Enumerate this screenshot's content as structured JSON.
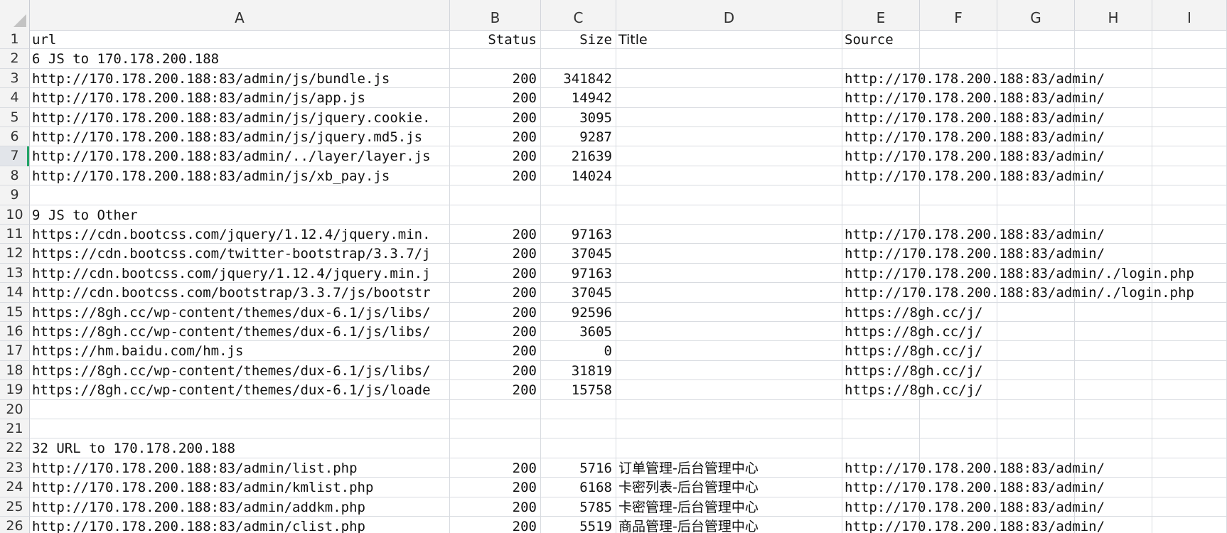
{
  "columns": [
    "A",
    "B",
    "C",
    "D",
    "E",
    "F",
    "G",
    "H",
    "I"
  ],
  "rows": [
    {
      "n": "1",
      "A": "url",
      "B": "Status",
      "C": "Size",
      "D": "Title",
      "E": "Source"
    },
    {
      "n": "2",
      "A": "6 JS to 170.178.200.188"
    },
    {
      "n": "3",
      "A": "http://170.178.200.188:83/admin/js/bundle.js",
      "B": "200",
      "C": "341842",
      "D": "",
      "E": "http://170.178.200.188:83/admin/"
    },
    {
      "n": "4",
      "A": "http://170.178.200.188:83/admin/js/app.js",
      "B": "200",
      "C": "14942",
      "D": "",
      "E": "http://170.178.200.188:83/admin/"
    },
    {
      "n": "5",
      "A": "http://170.178.200.188:83/admin/js/jquery.cookie.",
      "B": "200",
      "C": "3095",
      "D": "",
      "E": "http://170.178.200.188:83/admin/"
    },
    {
      "n": "6",
      "A": "http://170.178.200.188:83/admin/js/jquery.md5.js",
      "B": "200",
      "C": "9287",
      "D": "",
      "E": "http://170.178.200.188:83/admin/"
    },
    {
      "n": "7",
      "A": "http://170.178.200.188:83/admin/../layer/layer.js",
      "B": "200",
      "C": "21639",
      "D": "",
      "E": "http://170.178.200.188:83/admin/"
    },
    {
      "n": "8",
      "A": "http://170.178.200.188:83/admin/js/xb_pay.js",
      "B": "200",
      "C": "14024",
      "D": "",
      "E": "http://170.178.200.188:83/admin/"
    },
    {
      "n": "9"
    },
    {
      "n": "10",
      "A": "9 JS to Other"
    },
    {
      "n": "11",
      "A": "https://cdn.bootcss.com/jquery/1.12.4/jquery.min.",
      "B": "200",
      "C": "97163",
      "D": "",
      "E": "http://170.178.200.188:83/admin/"
    },
    {
      "n": "12",
      "A": "https://cdn.bootcss.com/twitter-bootstrap/3.3.7/j",
      "B": "200",
      "C": "37045",
      "D": "",
      "E": "http://170.178.200.188:83/admin/"
    },
    {
      "n": "13",
      "A": "http://cdn.bootcss.com/jquery/1.12.4/jquery.min.j",
      "B": "200",
      "C": "97163",
      "D": "",
      "E": "http://170.178.200.188:83/admin/./login.php"
    },
    {
      "n": "14",
      "A": "http://cdn.bootcss.com/bootstrap/3.3.7/js/bootstr",
      "B": "200",
      "C": "37045",
      "D": "",
      "E": "http://170.178.200.188:83/admin/./login.php"
    },
    {
      "n": "15",
      "A": "https://8gh.cc/wp-content/themes/dux-6.1/js/libs/",
      "B": "200",
      "C": "92596",
      "D": "",
      "E": "https://8gh.cc/j/"
    },
    {
      "n": "16",
      "A": "https://8gh.cc/wp-content/themes/dux-6.1/js/libs/",
      "B": "200",
      "C": "3605",
      "D": "",
      "E": "https://8gh.cc/j/"
    },
    {
      "n": "17",
      "A": "https://hm.baidu.com/hm.js",
      "B": "200",
      "C": "0",
      "D": "",
      "E": "https://8gh.cc/j/"
    },
    {
      "n": "18",
      "A": "https://8gh.cc/wp-content/themes/dux-6.1/js/libs/",
      "B": "200",
      "C": "31819",
      "D": "",
      "E": "https://8gh.cc/j/"
    },
    {
      "n": "19",
      "A": "https://8gh.cc/wp-content/themes/dux-6.1/js/loade",
      "B": "200",
      "C": "15758",
      "D": "",
      "E": "https://8gh.cc/j/"
    },
    {
      "n": "20"
    },
    {
      "n": "21"
    },
    {
      "n": "22",
      "A": "32 URL to 170.178.200.188"
    },
    {
      "n": "23",
      "A": "http://170.178.200.188:83/admin/list.php",
      "B": "200",
      "C": "5716",
      "D": "订单管理-后台管理中心",
      "E": "http://170.178.200.188:83/admin/"
    },
    {
      "n": "24",
      "A": "http://170.178.200.188:83/admin/kmlist.php",
      "B": "200",
      "C": "6168",
      "D": "卡密列表-后台管理中心",
      "E": "http://170.178.200.188:83/admin/"
    },
    {
      "n": "25",
      "A": "http://170.178.200.188:83/admin/addkm.php",
      "B": "200",
      "C": "5785",
      "D": "卡密管理-后台管理中心",
      "E": "http://170.178.200.188:83/admin/"
    },
    {
      "n": "26",
      "A": "http://170.178.200.188:83/admin/clist.php",
      "B": "200",
      "C": "5519",
      "D": "商品管理-后台管理中心",
      "E": "http://170.178.200.188:83/admin/"
    }
  ],
  "selected_row": "7",
  "colors": {
    "grid": "#d8dbe0",
    "header_bg": "#f3f3f3",
    "selection": "#21a366"
  }
}
